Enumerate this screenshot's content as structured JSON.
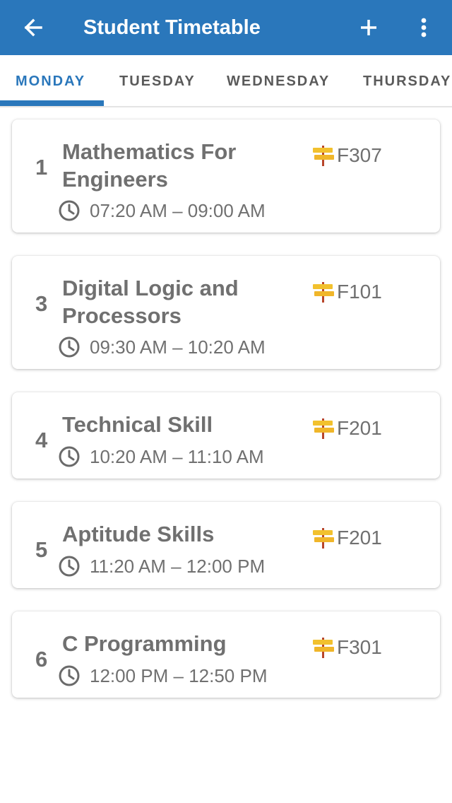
{
  "appbar": {
    "title": "Student Timetable",
    "color": "#2a77bb",
    "icons": [
      "arrow-back-icon",
      "plus-icon",
      "more-vert-icon"
    ]
  },
  "tabs": [
    {
      "label": "MONDAY",
      "active": true
    },
    {
      "label": "TUESDAY",
      "active": false
    },
    {
      "label": "WEDNESDAY",
      "active": false
    },
    {
      "label": "THURSDAY",
      "active": false
    }
  ],
  "sessions": [
    {
      "period": "1",
      "subject": "Mathematics For Engineers",
      "time": "07:20 AM – 09:00 AM",
      "room": "F307"
    },
    {
      "period": "3",
      "subject": "Digital Logic and Processors",
      "time": "09:30 AM – 10:20 AM",
      "room": "F101"
    },
    {
      "period": "4",
      "subject": "Technical Skill",
      "time": "10:20 AM – 11:10 AM",
      "room": "F201"
    },
    {
      "period": "5",
      "subject": "Aptitude Skills",
      "time": "11:20 AM – 12:00 PM",
      "room": "F201"
    },
    {
      "period": "6",
      "subject": "C Programming",
      "time": "12:00 PM – 12:50 PM",
      "room": "F301"
    }
  ]
}
